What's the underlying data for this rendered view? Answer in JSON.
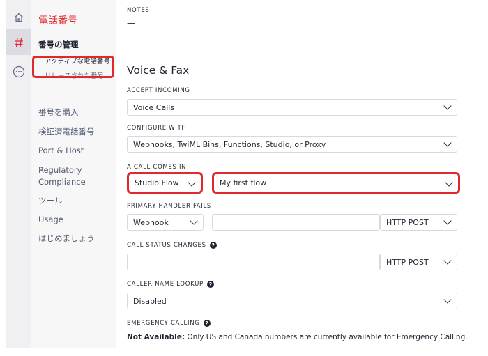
{
  "rail": {
    "home_icon": "home-icon",
    "hash_icon": "hash-icon",
    "more_icon": "more-icon",
    "accent": "#e2282b"
  },
  "sidebar": {
    "title": "電話番号",
    "section": "番号の管理",
    "sub_items": [
      "アクティブな電話番号",
      "リリースされた番号"
    ],
    "items": [
      "番号を購入",
      "検証済電話番号",
      "Port & Host",
      "Regulatory Compliance",
      "ツール",
      "Usage",
      "はじめましょう"
    ]
  },
  "main": {
    "notes_label": "NOTES",
    "notes_value": "—",
    "heading": "Voice & Fax",
    "accept_incoming": {
      "label": "ACCEPT INCOMING",
      "value": "Voice Calls"
    },
    "configure_with": {
      "label": "CONFIGURE WITH",
      "value": "Webhooks, TwiML Bins, Functions, Studio, or Proxy"
    },
    "call_comes_in": {
      "label": "A CALL COMES IN",
      "type": "Studio Flow",
      "flow": "My first flow"
    },
    "primary_handler": {
      "label": "PRIMARY HANDLER FAILS",
      "type": "Webhook",
      "url": "",
      "method": "HTTP POST"
    },
    "call_status": {
      "label": "CALL STATUS CHANGES",
      "url": "",
      "method": "HTTP POST"
    },
    "caller_name": {
      "label": "CALLER NAME LOOKUP",
      "value": "Disabled"
    },
    "emergency": {
      "label": "EMERGENCY CALLING",
      "strong": "Not Available:",
      "text": " Only US and Canada numbers are currently available for Emergency Calling."
    }
  }
}
